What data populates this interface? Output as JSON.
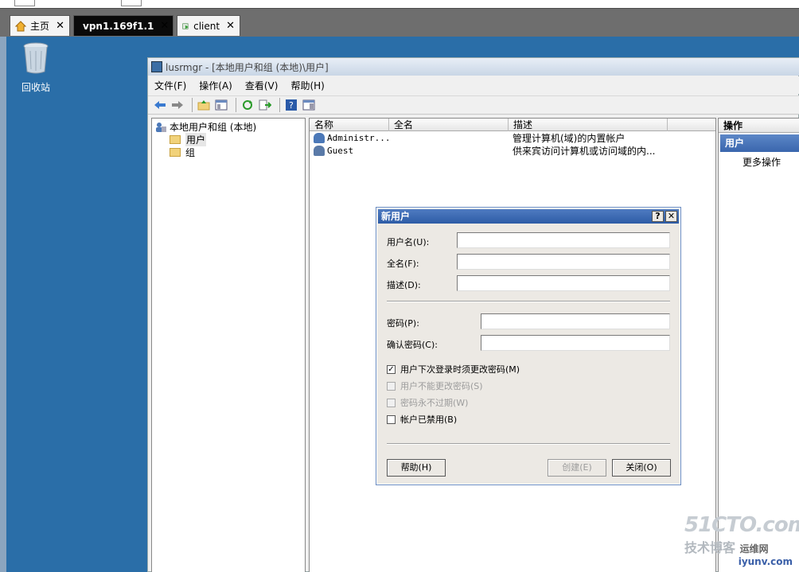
{
  "tabs": [
    {
      "label": "主页",
      "icon": "home-icon",
      "close": "✕"
    },
    {
      "label": "vpn1.169f1.1",
      "icon": "vm-icon",
      "close": "✕"
    },
    {
      "label": "client",
      "icon": "vm-play-icon",
      "close": "✕"
    }
  ],
  "desktop": {
    "recycle_label": "回收站"
  },
  "mmc": {
    "title": "lusrmgr - [本地用户和组 (本地)\\用户]",
    "menu": [
      "文件(F)",
      "操作(A)",
      "查看(V)",
      "帮助(H)"
    ],
    "tree": {
      "root": "本地用户和组 (本地)",
      "children": [
        "用户",
        "组"
      ]
    },
    "list": {
      "columns": [
        "名称",
        "全名",
        "描述"
      ],
      "rows": [
        {
          "name": "Administr...",
          "fullname": "",
          "desc": "管理计算机(域)的内置帐户"
        },
        {
          "name": "Guest",
          "fullname": "",
          "desc": "供来宾访问计算机或访问域的内..."
        }
      ]
    },
    "actions": {
      "header": "操作",
      "selected": "用户",
      "more": "更多操作"
    }
  },
  "dialog": {
    "title": "新用户",
    "help_btn": "?",
    "close_btn": "✕",
    "fields": {
      "username": {
        "label": "用户名(U):",
        "value": ""
      },
      "fullname": {
        "label": "全名(F):",
        "value": ""
      },
      "description": {
        "label": "描述(D):",
        "value": ""
      },
      "password": {
        "label": "密码(P):",
        "value": ""
      },
      "confirm": {
        "label": "确认密码(C):",
        "value": ""
      }
    },
    "checks": [
      {
        "label": "用户下次登录时须更改密码(M)",
        "checked": true,
        "disabled": false
      },
      {
        "label": "用户不能更改密码(S)",
        "checked": false,
        "disabled": true
      },
      {
        "label": "密码永不过期(W)",
        "checked": false,
        "disabled": true
      },
      {
        "label": "帐户已禁用(B)",
        "checked": false,
        "disabled": false
      }
    ],
    "buttons": {
      "help": "帮助(H)",
      "create": "创建(E)",
      "close": "关闭(O)"
    }
  },
  "watermark": {
    "line1": "51CTO.com",
    "line2": "技术博客",
    "line3": "运维网",
    "line4": "iyunv.com"
  }
}
